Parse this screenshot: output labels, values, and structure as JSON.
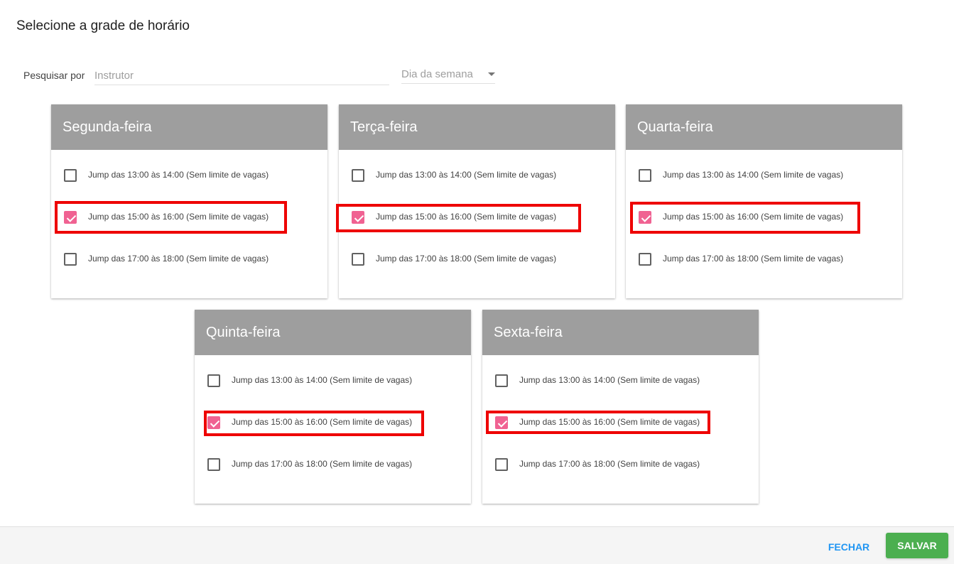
{
  "dialog": {
    "title": "Selecione a grade de horário"
  },
  "search": {
    "label": "Pesquisar por",
    "instructor_placeholder": "Instrutor",
    "instructor_value": "",
    "weekday_placeholder": "Dia da semana"
  },
  "days": [
    {
      "name": "Segunda-feira",
      "slots": [
        {
          "label": "Jump das 13:00 às 14:00 (Sem limite de vagas)",
          "checked": false
        },
        {
          "label": "Jump das 15:00 às 16:00 (Sem limite de vagas)",
          "checked": true
        },
        {
          "label": "Jump das 17:00 às 18:00 (Sem limite de vagas)",
          "checked": false
        }
      ]
    },
    {
      "name": "Terça-feira",
      "slots": [
        {
          "label": "Jump das 13:00 às 14:00 (Sem limite de vagas)",
          "checked": false
        },
        {
          "label": "Jump das 15:00 às 16:00 (Sem limite de vagas)",
          "checked": true
        },
        {
          "label": "Jump das 17:00 às 18:00 (Sem limite de vagas)",
          "checked": false
        }
      ]
    },
    {
      "name": "Quarta-feira",
      "slots": [
        {
          "label": "Jump das 13:00 às 14:00 (Sem limite de vagas)",
          "checked": false
        },
        {
          "label": "Jump das 15:00 às 16:00 (Sem limite de vagas)",
          "checked": true
        },
        {
          "label": "Jump das 17:00 às 18:00 (Sem limite de vagas)",
          "checked": false
        }
      ]
    },
    {
      "name": "Quinta-feira",
      "slots": [
        {
          "label": "Jump das 13:00 às 14:00 (Sem limite de vagas)",
          "checked": false
        },
        {
          "label": "Jump das 15:00 às 16:00 (Sem limite de vagas)",
          "checked": true
        },
        {
          "label": "Jump das 17:00 às 18:00 (Sem limite de vagas)",
          "checked": false
        }
      ]
    },
    {
      "name": "Sexta-feira",
      "slots": [
        {
          "label": "Jump das 13:00 às 14:00 (Sem limite de vagas)",
          "checked": false
        },
        {
          "label": "Jump das 15:00 às 16:00 (Sem limite de vagas)",
          "checked": true
        },
        {
          "label": "Jump das 17:00 às 18:00 (Sem limite de vagas)",
          "checked": false
        }
      ]
    }
  ],
  "footer": {
    "close_label": "FECHAR",
    "save_label": "SALVAR"
  },
  "colors": {
    "checkbox_checked": "#f06292",
    "card_header": "#9e9e9e",
    "highlight": "#ee0000",
    "close_button": "#2196f3",
    "save_button": "#4caf50"
  }
}
